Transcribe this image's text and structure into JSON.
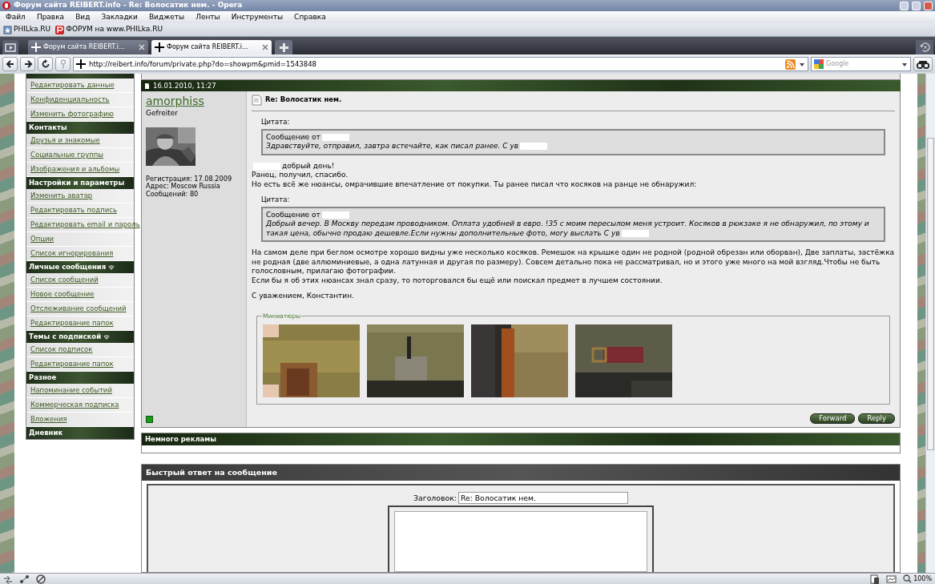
{
  "window": {
    "title": "Форум сайта REIBERT.info - Re: Волосатик нем. - Opera"
  },
  "menu": [
    "Файл",
    "Правка",
    "Вид",
    "Закладки",
    "Виджеты",
    "Ленты",
    "Инструменты",
    "Справка"
  ],
  "bookmarks": [
    "PHILka.RU",
    "ФОРУМ на www.PHILka.RU"
  ],
  "tabs": [
    {
      "label": "Форум сайта REIBERT.i...",
      "selected": false
    },
    {
      "label": "Форум сайта REIBERT.i...",
      "selected": true
    }
  ],
  "address": {
    "url": "http://reibert.info/forum/private.php?do=showpm&pmid=1543848",
    "search_placeholder": "Google"
  },
  "sidebar": [
    {
      "items": [
        "Редактировать данные",
        "Конфиденциальность",
        "Изменить фотографию"
      ]
    },
    {
      "title": "Контакты",
      "items": [
        "Друзья и знакомые",
        "Социальные группы",
        "Изображения и альбомы"
      ]
    },
    {
      "title": "Настройки и параметры",
      "items": [
        "Изменить аватар",
        "Редактировать подпись",
        "Редактировать email и пароль",
        "Опции",
        "Список игнорирования"
      ]
    },
    {
      "title": "Личные сообщения",
      "collapsible": true,
      "items": [
        "Список сообщений",
        "Новое сообщение",
        "Отслеживание сообщений",
        "Редактирование папок"
      ]
    },
    {
      "title": "Темы с подпиской",
      "collapsible": true,
      "items": [
        "Список подписок",
        "Редактирование папок"
      ]
    },
    {
      "title": "Разное",
      "items": [
        "Напоминание событий",
        "Коммерческая подписка",
        "Вложения"
      ]
    },
    {
      "title": "Дневник"
    }
  ],
  "post": {
    "date": "16.01.2010, 11:27",
    "username": "amorphiss",
    "user_title": "Gefreiter",
    "user_info": [
      "Регистрация: 17.08.2009",
      "Адрес: Moscow Russia",
      "Сообщений: 80"
    ],
    "online": true,
    "title": "Re: Волосатик нем.",
    "blocks": [
      {
        "kind": "quote",
        "label": "Цитата:",
        "from": "Сообщение от",
        "text": "Здравствуйте, отправил, завтра встечайте, как писал ранее. С ув"
      },
      {
        "kind": "text",
        "lines": [
          {
            "redacted": true,
            "text": "добрый день!"
          },
          {
            "text": "Ранец, получил, спасибо."
          },
          {
            "text": "Но есть всё же нюансы, омрачившие впечатление от покупки. Ты ранее писал что косяков на ранце не обнаружил:"
          }
        ]
      },
      {
        "kind": "quote",
        "label": "Цитата:",
        "from": "Сообщение от",
        "text": "Добрый вечер. В Москву передам проводником. Оплата удобней в евро. !35 с моим пересылом меня устроит. Косяков в рюкзаке я не обнаружил, по этому и такая цена, обычно продаю дешевле.Если нужны дополнительные фото, могу выслать С ув"
      },
      {
        "kind": "text",
        "lines": [
          {
            "text": "На самом деле при беглом осмотре хорошо видны уже несколько косяков. Ремешок на крышке один не родной (родной обрезан или оборван), Две заплаты, застёжка не родная (две аллюминиевые, а одна латунная и другая по размеру). Совсем детально пока не рассматривал, но и этого уже много на мой взгляд.Чтобы не быть голословным, прилагаю фотографии."
          },
          {
            "text": "Если бы я об этих нюансах знал сразу, то поторговался бы ещё или поискал предмет в лучшем состоянии."
          }
        ]
      },
      {
        "kind": "text",
        "lines": [
          {
            "text": "С уважением, Константин."
          }
        ]
      }
    ],
    "thumbnails_label": "Миниатюры",
    "thumbnails": [
      {
        "kind": "picture"
      },
      {
        "kind": "picture"
      },
      {
        "kind": "picture"
      },
      {
        "kind": "picture"
      }
    ],
    "buttons": [
      "Forward",
      "Reply"
    ]
  },
  "ads_title": "Немного рекламы",
  "quick_reply": {
    "title": "Быстрый ответ на сообщение",
    "subject_label": "Заголовок:",
    "subject_value": "Re: Волосатик нем."
  },
  "status_bar": {
    "zoom": "100%"
  }
}
